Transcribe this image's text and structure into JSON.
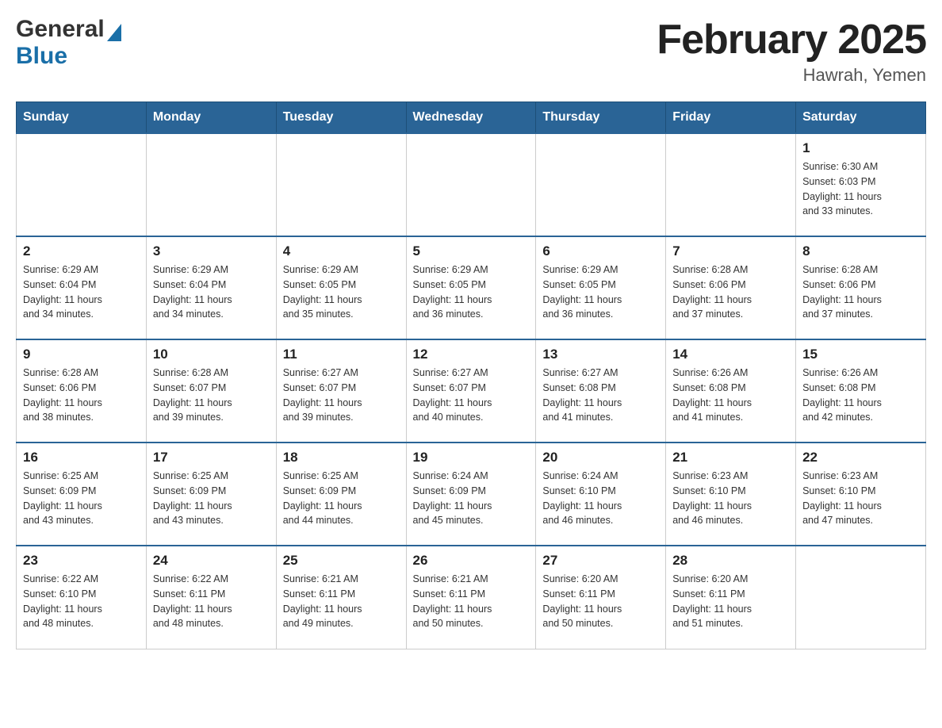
{
  "header": {
    "month_title": "February 2025",
    "location": "Hawrah, Yemen",
    "logo_general": "General",
    "logo_blue": "Blue"
  },
  "weekdays": [
    "Sunday",
    "Monday",
    "Tuesday",
    "Wednesday",
    "Thursday",
    "Friday",
    "Saturday"
  ],
  "weeks": [
    [
      {
        "day": "",
        "info": ""
      },
      {
        "day": "",
        "info": ""
      },
      {
        "day": "",
        "info": ""
      },
      {
        "day": "",
        "info": ""
      },
      {
        "day": "",
        "info": ""
      },
      {
        "day": "",
        "info": ""
      },
      {
        "day": "1",
        "info": "Sunrise: 6:30 AM\nSunset: 6:03 PM\nDaylight: 11 hours\nand 33 minutes."
      }
    ],
    [
      {
        "day": "2",
        "info": "Sunrise: 6:29 AM\nSunset: 6:04 PM\nDaylight: 11 hours\nand 34 minutes."
      },
      {
        "day": "3",
        "info": "Sunrise: 6:29 AM\nSunset: 6:04 PM\nDaylight: 11 hours\nand 34 minutes."
      },
      {
        "day": "4",
        "info": "Sunrise: 6:29 AM\nSunset: 6:05 PM\nDaylight: 11 hours\nand 35 minutes."
      },
      {
        "day": "5",
        "info": "Sunrise: 6:29 AM\nSunset: 6:05 PM\nDaylight: 11 hours\nand 36 minutes."
      },
      {
        "day": "6",
        "info": "Sunrise: 6:29 AM\nSunset: 6:05 PM\nDaylight: 11 hours\nand 36 minutes."
      },
      {
        "day": "7",
        "info": "Sunrise: 6:28 AM\nSunset: 6:06 PM\nDaylight: 11 hours\nand 37 minutes."
      },
      {
        "day": "8",
        "info": "Sunrise: 6:28 AM\nSunset: 6:06 PM\nDaylight: 11 hours\nand 37 minutes."
      }
    ],
    [
      {
        "day": "9",
        "info": "Sunrise: 6:28 AM\nSunset: 6:06 PM\nDaylight: 11 hours\nand 38 minutes."
      },
      {
        "day": "10",
        "info": "Sunrise: 6:28 AM\nSunset: 6:07 PM\nDaylight: 11 hours\nand 39 minutes."
      },
      {
        "day": "11",
        "info": "Sunrise: 6:27 AM\nSunset: 6:07 PM\nDaylight: 11 hours\nand 39 minutes."
      },
      {
        "day": "12",
        "info": "Sunrise: 6:27 AM\nSunset: 6:07 PM\nDaylight: 11 hours\nand 40 minutes."
      },
      {
        "day": "13",
        "info": "Sunrise: 6:27 AM\nSunset: 6:08 PM\nDaylight: 11 hours\nand 41 minutes."
      },
      {
        "day": "14",
        "info": "Sunrise: 6:26 AM\nSunset: 6:08 PM\nDaylight: 11 hours\nand 41 minutes."
      },
      {
        "day": "15",
        "info": "Sunrise: 6:26 AM\nSunset: 6:08 PM\nDaylight: 11 hours\nand 42 minutes."
      }
    ],
    [
      {
        "day": "16",
        "info": "Sunrise: 6:25 AM\nSunset: 6:09 PM\nDaylight: 11 hours\nand 43 minutes."
      },
      {
        "day": "17",
        "info": "Sunrise: 6:25 AM\nSunset: 6:09 PM\nDaylight: 11 hours\nand 43 minutes."
      },
      {
        "day": "18",
        "info": "Sunrise: 6:25 AM\nSunset: 6:09 PM\nDaylight: 11 hours\nand 44 minutes."
      },
      {
        "day": "19",
        "info": "Sunrise: 6:24 AM\nSunset: 6:09 PM\nDaylight: 11 hours\nand 45 minutes."
      },
      {
        "day": "20",
        "info": "Sunrise: 6:24 AM\nSunset: 6:10 PM\nDaylight: 11 hours\nand 46 minutes."
      },
      {
        "day": "21",
        "info": "Sunrise: 6:23 AM\nSunset: 6:10 PM\nDaylight: 11 hours\nand 46 minutes."
      },
      {
        "day": "22",
        "info": "Sunrise: 6:23 AM\nSunset: 6:10 PM\nDaylight: 11 hours\nand 47 minutes."
      }
    ],
    [
      {
        "day": "23",
        "info": "Sunrise: 6:22 AM\nSunset: 6:10 PM\nDaylight: 11 hours\nand 48 minutes."
      },
      {
        "day": "24",
        "info": "Sunrise: 6:22 AM\nSunset: 6:11 PM\nDaylight: 11 hours\nand 48 minutes."
      },
      {
        "day": "25",
        "info": "Sunrise: 6:21 AM\nSunset: 6:11 PM\nDaylight: 11 hours\nand 49 minutes."
      },
      {
        "day": "26",
        "info": "Sunrise: 6:21 AM\nSunset: 6:11 PM\nDaylight: 11 hours\nand 50 minutes."
      },
      {
        "day": "27",
        "info": "Sunrise: 6:20 AM\nSunset: 6:11 PM\nDaylight: 11 hours\nand 50 minutes."
      },
      {
        "day": "28",
        "info": "Sunrise: 6:20 AM\nSunset: 6:11 PM\nDaylight: 11 hours\nand 51 minutes."
      },
      {
        "day": "",
        "info": ""
      }
    ]
  ]
}
